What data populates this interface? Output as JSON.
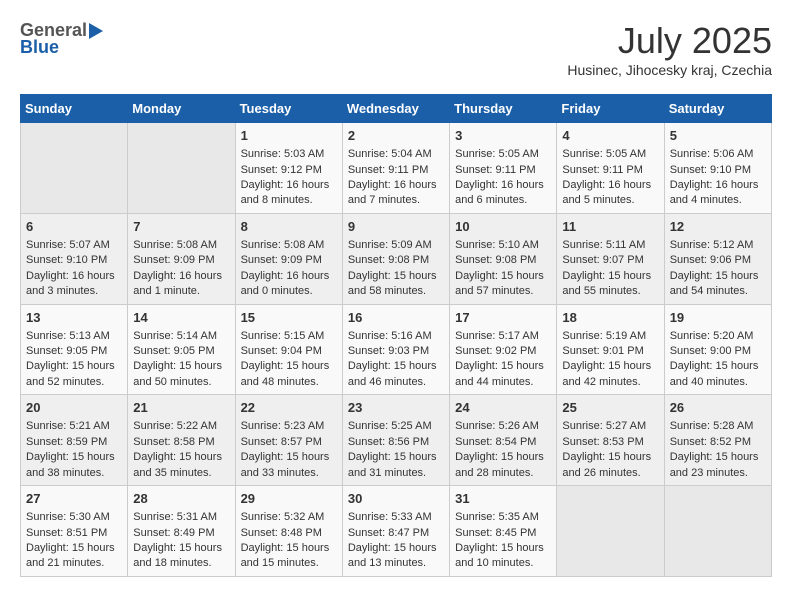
{
  "header": {
    "logo_general": "General",
    "logo_blue": "Blue",
    "month": "July 2025",
    "location": "Husinec, Jihocesky kraj, Czechia"
  },
  "days_of_week": [
    "Sunday",
    "Monday",
    "Tuesday",
    "Wednesday",
    "Thursday",
    "Friday",
    "Saturday"
  ],
  "weeks": [
    [
      {
        "day": "",
        "empty": true
      },
      {
        "day": "",
        "empty": true
      },
      {
        "day": "1",
        "sunrise": "Sunrise: 5:03 AM",
        "sunset": "Sunset: 9:12 PM",
        "daylight": "Daylight: 16 hours and 8 minutes."
      },
      {
        "day": "2",
        "sunrise": "Sunrise: 5:04 AM",
        "sunset": "Sunset: 9:11 PM",
        "daylight": "Daylight: 16 hours and 7 minutes."
      },
      {
        "day": "3",
        "sunrise": "Sunrise: 5:05 AM",
        "sunset": "Sunset: 9:11 PM",
        "daylight": "Daylight: 16 hours and 6 minutes."
      },
      {
        "day": "4",
        "sunrise": "Sunrise: 5:05 AM",
        "sunset": "Sunset: 9:11 PM",
        "daylight": "Daylight: 16 hours and 5 minutes."
      },
      {
        "day": "5",
        "sunrise": "Sunrise: 5:06 AM",
        "sunset": "Sunset: 9:10 PM",
        "daylight": "Daylight: 16 hours and 4 minutes."
      }
    ],
    [
      {
        "day": "6",
        "sunrise": "Sunrise: 5:07 AM",
        "sunset": "Sunset: 9:10 PM",
        "daylight": "Daylight: 16 hours and 3 minutes."
      },
      {
        "day": "7",
        "sunrise": "Sunrise: 5:08 AM",
        "sunset": "Sunset: 9:09 PM",
        "daylight": "Daylight: 16 hours and 1 minute."
      },
      {
        "day": "8",
        "sunrise": "Sunrise: 5:08 AM",
        "sunset": "Sunset: 9:09 PM",
        "daylight": "Daylight: 16 hours and 0 minutes."
      },
      {
        "day": "9",
        "sunrise": "Sunrise: 5:09 AM",
        "sunset": "Sunset: 9:08 PM",
        "daylight": "Daylight: 15 hours and 58 minutes."
      },
      {
        "day": "10",
        "sunrise": "Sunrise: 5:10 AM",
        "sunset": "Sunset: 9:08 PM",
        "daylight": "Daylight: 15 hours and 57 minutes."
      },
      {
        "day": "11",
        "sunrise": "Sunrise: 5:11 AM",
        "sunset": "Sunset: 9:07 PM",
        "daylight": "Daylight: 15 hours and 55 minutes."
      },
      {
        "day": "12",
        "sunrise": "Sunrise: 5:12 AM",
        "sunset": "Sunset: 9:06 PM",
        "daylight": "Daylight: 15 hours and 54 minutes."
      }
    ],
    [
      {
        "day": "13",
        "sunrise": "Sunrise: 5:13 AM",
        "sunset": "Sunset: 9:05 PM",
        "daylight": "Daylight: 15 hours and 52 minutes."
      },
      {
        "day": "14",
        "sunrise": "Sunrise: 5:14 AM",
        "sunset": "Sunset: 9:05 PM",
        "daylight": "Daylight: 15 hours and 50 minutes."
      },
      {
        "day": "15",
        "sunrise": "Sunrise: 5:15 AM",
        "sunset": "Sunset: 9:04 PM",
        "daylight": "Daylight: 15 hours and 48 minutes."
      },
      {
        "day": "16",
        "sunrise": "Sunrise: 5:16 AM",
        "sunset": "Sunset: 9:03 PM",
        "daylight": "Daylight: 15 hours and 46 minutes."
      },
      {
        "day": "17",
        "sunrise": "Sunrise: 5:17 AM",
        "sunset": "Sunset: 9:02 PM",
        "daylight": "Daylight: 15 hours and 44 minutes."
      },
      {
        "day": "18",
        "sunrise": "Sunrise: 5:19 AM",
        "sunset": "Sunset: 9:01 PM",
        "daylight": "Daylight: 15 hours and 42 minutes."
      },
      {
        "day": "19",
        "sunrise": "Sunrise: 5:20 AM",
        "sunset": "Sunset: 9:00 PM",
        "daylight": "Daylight: 15 hours and 40 minutes."
      }
    ],
    [
      {
        "day": "20",
        "sunrise": "Sunrise: 5:21 AM",
        "sunset": "Sunset: 8:59 PM",
        "daylight": "Daylight: 15 hours and 38 minutes."
      },
      {
        "day": "21",
        "sunrise": "Sunrise: 5:22 AM",
        "sunset": "Sunset: 8:58 PM",
        "daylight": "Daylight: 15 hours and 35 minutes."
      },
      {
        "day": "22",
        "sunrise": "Sunrise: 5:23 AM",
        "sunset": "Sunset: 8:57 PM",
        "daylight": "Daylight: 15 hours and 33 minutes."
      },
      {
        "day": "23",
        "sunrise": "Sunrise: 5:25 AM",
        "sunset": "Sunset: 8:56 PM",
        "daylight": "Daylight: 15 hours and 31 minutes."
      },
      {
        "day": "24",
        "sunrise": "Sunrise: 5:26 AM",
        "sunset": "Sunset: 8:54 PM",
        "daylight": "Daylight: 15 hours and 28 minutes."
      },
      {
        "day": "25",
        "sunrise": "Sunrise: 5:27 AM",
        "sunset": "Sunset: 8:53 PM",
        "daylight": "Daylight: 15 hours and 26 minutes."
      },
      {
        "day": "26",
        "sunrise": "Sunrise: 5:28 AM",
        "sunset": "Sunset: 8:52 PM",
        "daylight": "Daylight: 15 hours and 23 minutes."
      }
    ],
    [
      {
        "day": "27",
        "sunrise": "Sunrise: 5:30 AM",
        "sunset": "Sunset: 8:51 PM",
        "daylight": "Daylight: 15 hours and 21 minutes."
      },
      {
        "day": "28",
        "sunrise": "Sunrise: 5:31 AM",
        "sunset": "Sunset: 8:49 PM",
        "daylight": "Daylight: 15 hours and 18 minutes."
      },
      {
        "day": "29",
        "sunrise": "Sunrise: 5:32 AM",
        "sunset": "Sunset: 8:48 PM",
        "daylight": "Daylight: 15 hours and 15 minutes."
      },
      {
        "day": "30",
        "sunrise": "Sunrise: 5:33 AM",
        "sunset": "Sunset: 8:47 PM",
        "daylight": "Daylight: 15 hours and 13 minutes."
      },
      {
        "day": "31",
        "sunrise": "Sunrise: 5:35 AM",
        "sunset": "Sunset: 8:45 PM",
        "daylight": "Daylight: 15 hours and 10 minutes."
      },
      {
        "day": "",
        "empty": true
      },
      {
        "day": "",
        "empty": true
      }
    ]
  ]
}
